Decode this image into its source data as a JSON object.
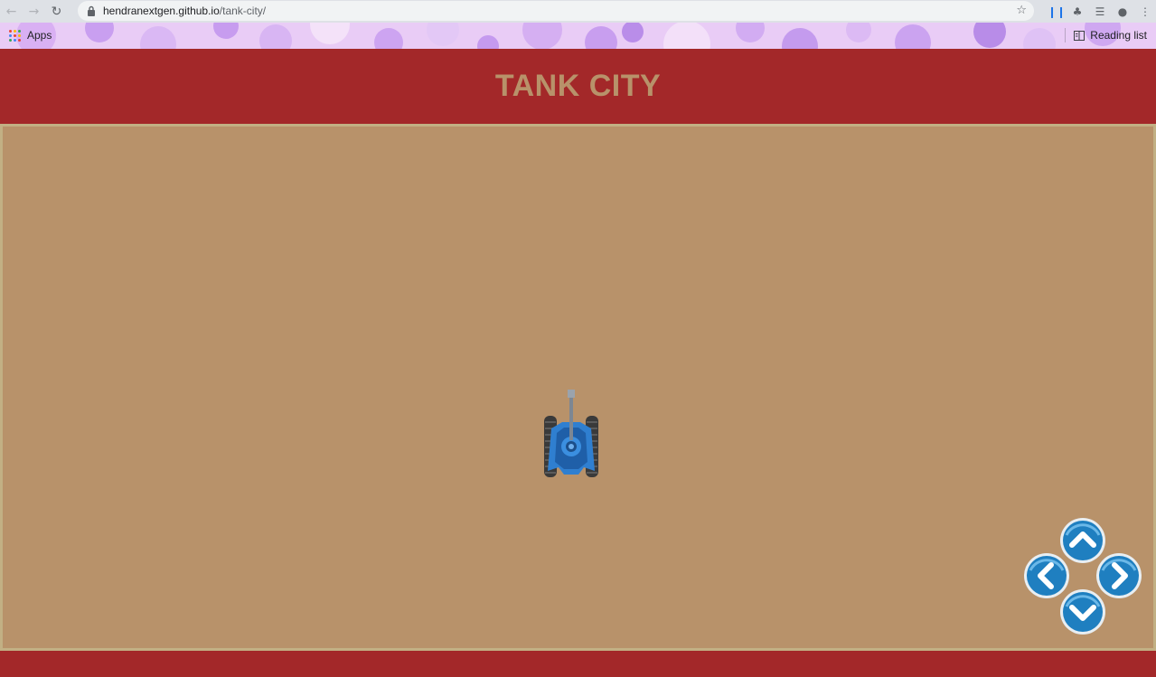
{
  "browser": {
    "url_host": "hendranextgen.github.io",
    "url_path": "/tank-city/",
    "bookmarks": {
      "apps_label": "Apps",
      "reading_list_label": "Reading list"
    }
  },
  "page": {
    "title": "TANK CITY",
    "colors": {
      "header": "#a32829",
      "arena": "#b8926a",
      "title": "#b8926a",
      "tank": "#2f7fd0",
      "dpad": "#1f7fc0"
    }
  },
  "controls": [
    "up-arrow",
    "left-arrow",
    "right-arrow",
    "down-arrow"
  ]
}
